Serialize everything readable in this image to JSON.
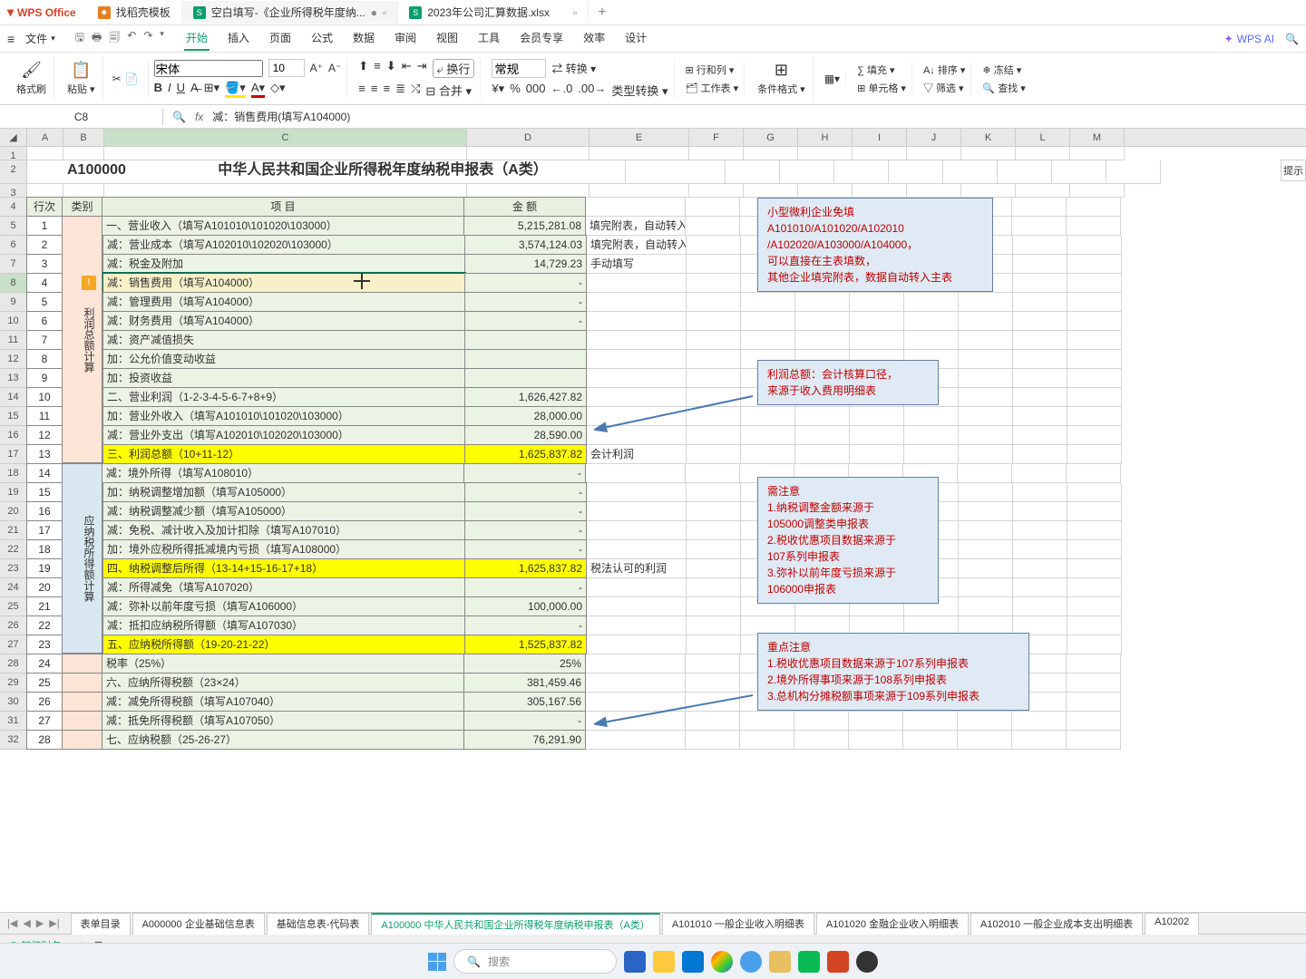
{
  "app": {
    "name": "WPS Office"
  },
  "tabs": [
    {
      "label": "找稻壳模板",
      "icon": "orange"
    },
    {
      "label": "空白填写-《企业所得税年度纳...",
      "icon": "green",
      "modified": true
    },
    {
      "label": "2023年公司汇算数据.xlsx",
      "icon": "green"
    }
  ],
  "menu": {
    "file": "文件",
    "items": [
      "开始",
      "插入",
      "页面",
      "公式",
      "数据",
      "审阅",
      "视图",
      "工具",
      "会员专享",
      "效率",
      "设计"
    ],
    "active": "开始",
    "wps_ai": "WPS AI"
  },
  "ribbon": {
    "format_painter": "格式刷",
    "paste": "粘贴",
    "font": "宋体",
    "size": "10",
    "wrap": "换行",
    "merge": "合并",
    "number_format": "常规",
    "convert": "转换",
    "rows_cols": "行和列",
    "worksheet": "工作表",
    "cond_fmt": "条件格式",
    "fill": "填充",
    "cell": "单元格",
    "sort": "排序",
    "freeze": "冻结",
    "filter": "筛选",
    "find": "查找"
  },
  "formula": {
    "cell_ref": "C8",
    "content": "减：销售费用(填写A104000)"
  },
  "columns": [
    "A",
    "B",
    "C",
    "D",
    "E",
    "F",
    "G",
    "H",
    "I",
    "J",
    "K",
    "L",
    "M"
  ],
  "title": {
    "code": "A100000",
    "name": "中华人民共和国企业所得税年度纳税申报表（A类）"
  },
  "headers": {
    "row_no": "行次",
    "category": "类别",
    "item": "项    目",
    "amount": "金    额"
  },
  "cat1": "利润总额计算",
  "cat2": "应纳税所得额计算",
  "rows": [
    {
      "n": "1",
      "item": "一、营业收入（填写A101010\\101020\\103000）",
      "amt": "5,215,281.08",
      "note": "填完附表，自动转入"
    },
    {
      "n": "2",
      "item": "    减：营业成本（填写A102010\\102020\\103000）",
      "amt": "3,574,124.03",
      "note": "填完附表，自动转入"
    },
    {
      "n": "3",
      "item": "    减：税金及附加",
      "amt": "14,729.23",
      "note": "手动填写"
    },
    {
      "n": "4",
      "item": "    减：销售费用（填写A104000）",
      "amt": "-",
      "sel": true
    },
    {
      "n": "5",
      "item": "    减：管理费用（填写A104000）",
      "amt": "-"
    },
    {
      "n": "6",
      "item": "    减：财务费用（填写A104000）",
      "amt": "-"
    },
    {
      "n": "7",
      "item": "    减：资产减值损失",
      "amt": ""
    },
    {
      "n": "8",
      "item": "    加：公允价值变动收益",
      "amt": ""
    },
    {
      "n": "9",
      "item": "    加：投资收益",
      "amt": ""
    },
    {
      "n": "10",
      "item": "二、营业利润（1-2-3-4-5-6-7+8+9）",
      "amt": "1,626,427.82"
    },
    {
      "n": "11",
      "item": "    加：营业外收入（填写A101010\\101020\\103000）",
      "amt": "28,000.00"
    },
    {
      "n": "12",
      "item": "    减：营业外支出（填写A102010\\102020\\103000）",
      "amt": "28,590.00"
    },
    {
      "n": "13",
      "item": "三、利润总额（10+11-12）",
      "amt": "1,625,837.82",
      "hl": "yellow",
      "note": "会计利润"
    },
    {
      "n": "14",
      "item": "    减：境外所得（填写A108010）",
      "amt": "-"
    },
    {
      "n": "15",
      "item": "    加：纳税调整增加额（填写A105000）",
      "amt": "-"
    },
    {
      "n": "16",
      "item": "    减：纳税调整减少额（填写A105000）",
      "amt": "-"
    },
    {
      "n": "17",
      "item": "    减：免税、减计收入及加计扣除（填写A107010）",
      "amt": "-"
    },
    {
      "n": "18",
      "item": "    加：境外应税所得抵减境内亏损（填写A108000）",
      "amt": "-"
    },
    {
      "n": "19",
      "item": "四、纳税调整后所得（13-14+15-16-17+18）",
      "amt": "1,625,837.82",
      "hl": "yellow",
      "note": "税法认可的利润"
    },
    {
      "n": "20",
      "item": "    减：所得减免（填写A107020）",
      "amt": "-"
    },
    {
      "n": "21",
      "item": "    减：弥补以前年度亏损（填写A106000）",
      "amt": "100,000.00"
    },
    {
      "n": "22",
      "item": "    减：抵扣应纳税所得额（填写A107030）",
      "amt": "-"
    },
    {
      "n": "23",
      "item": "五、应纳税所得额（19-20-21-22）",
      "amt": "1,525,837.82",
      "hl": "yellow"
    },
    {
      "n": "24",
      "item": "税率（25%）",
      "amt": "25%"
    },
    {
      "n": "25",
      "item": "六、应纳所得税额（23×24）",
      "amt": "381,459.46"
    },
    {
      "n": "26",
      "item": "    减：减免所得税额（填写A107040）",
      "amt": "305,167.56"
    },
    {
      "n": "27",
      "item": "    减：抵免所得税额（填写A107050）",
      "amt": "-"
    },
    {
      "n": "28",
      "item": "七、应纳税额（25-26-27）",
      "amt": "76,291.90"
    }
  ],
  "annos": {
    "a1": [
      "小型微利企业免填",
      "A101010/A101020/A102010",
      "/A102020/A103000/A104000，",
      "可以直接在主表填数，",
      "其他企业填完附表，数据自动转入主表"
    ],
    "a2": [
      "利润总额：会计核算口径，",
      "来源于收入费用明细表"
    ],
    "a3": [
      "需注意",
      "1.纳税调整金额来源于",
      "105000调整类申报表",
      "2.税收优惠项目数据来源于",
      "107系列申报表",
      "3.弥补以前年度亏损来源于",
      "106000申报表"
    ],
    "a4": [
      "重点注意",
      "1.税收优惠项目数据来源于107系列申报表",
      "2.境外所得事项来源于108系列申报表",
      "3.总机构分摊税额事项来源于109系列申报表"
    ]
  },
  "sheet_tabs": [
    "表单目录",
    "A000000 企业基础信息表",
    "基础信息表-代码表",
    "A100000 中华人民共和国企业所得税年度纳税申报表（A类）",
    "A101010 一般企业收入明细表",
    "A101020 金融企业收入明细表",
    "A102010 一般企业成本支出明细表",
    "A10202"
  ],
  "sheet_tab_active": 3,
  "status": {
    "ai_finance": "智能财务"
  },
  "right_hint": "提示",
  "taskbar_search": "搜索"
}
